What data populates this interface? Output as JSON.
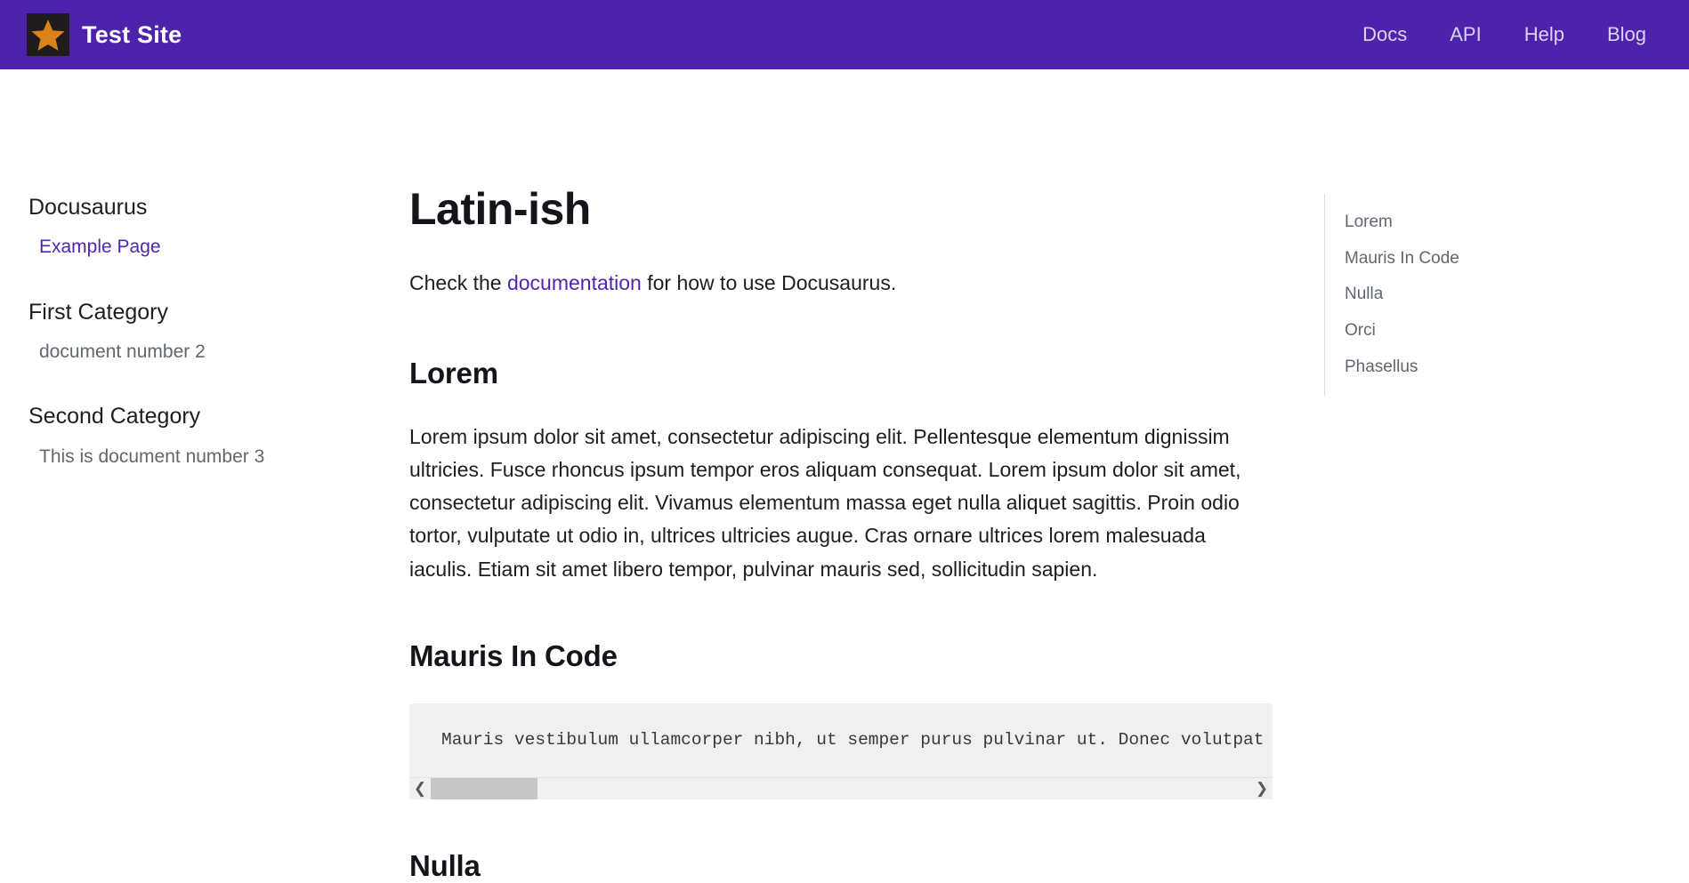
{
  "navbar": {
    "logo_icon": "star-icon",
    "brand_title": "Test Site",
    "links": [
      {
        "label": "Docs"
      },
      {
        "label": "API"
      },
      {
        "label": "Help"
      },
      {
        "label": "Blog"
      }
    ]
  },
  "sidebar": {
    "groups": [
      {
        "category": "Docusaurus",
        "items": [
          {
            "label": "Example Page",
            "active": true
          }
        ]
      },
      {
        "category": "First Category",
        "items": [
          {
            "label": "document number 2",
            "active": false
          }
        ]
      },
      {
        "category": "Second Category",
        "items": [
          {
            "label": "This is document number 3",
            "active": false
          }
        ]
      }
    ]
  },
  "main": {
    "title": "Latin-ish",
    "lead_before": "Check the ",
    "lead_link": "documentation",
    "lead_after": " for how to use Docusaurus.",
    "sections": {
      "lorem_heading": "Lorem",
      "lorem_paragraph": "Lorem ipsum dolor sit amet, consectetur adipiscing elit. Pellentesque elementum dignissim ultricies. Fusce rhoncus ipsum tempor eros aliquam consequat. Lorem ipsum dolor sit amet, consectetur adipiscing elit. Vivamus elementum massa eget nulla aliquet sagittis. Proin odio tortor, vulputate ut odio in, ultrices ultricies augue. Cras ornare ultrices lorem malesuada iaculis. Etiam sit amet libero tempor, pulvinar mauris sed, sollicitudin sapien.",
      "mauris_heading": "Mauris In Code",
      "code_text": "Mauris vestibulum ullamcorper nibh, ut semper purus pulvinar ut. Donec volutpat orci",
      "nulla_heading": "Nulla"
    },
    "scrollbar": {
      "left_arrow": "chevron-left-icon",
      "right_arrow": "chevron-right-icon"
    }
  },
  "toc": {
    "links": [
      {
        "label": "Lorem"
      },
      {
        "label": "Mauris In Code"
      },
      {
        "label": "Nulla"
      },
      {
        "label": "Orci"
      },
      {
        "label": "Phasellus"
      }
    ]
  },
  "colors": {
    "navbar_background": "#4d23ab",
    "link_purple": "#5025b0",
    "logo_star": "#d98218",
    "logo_background": "#1e1c1c",
    "code_background": "#f0f0f0",
    "muted_text": "#606770"
  }
}
